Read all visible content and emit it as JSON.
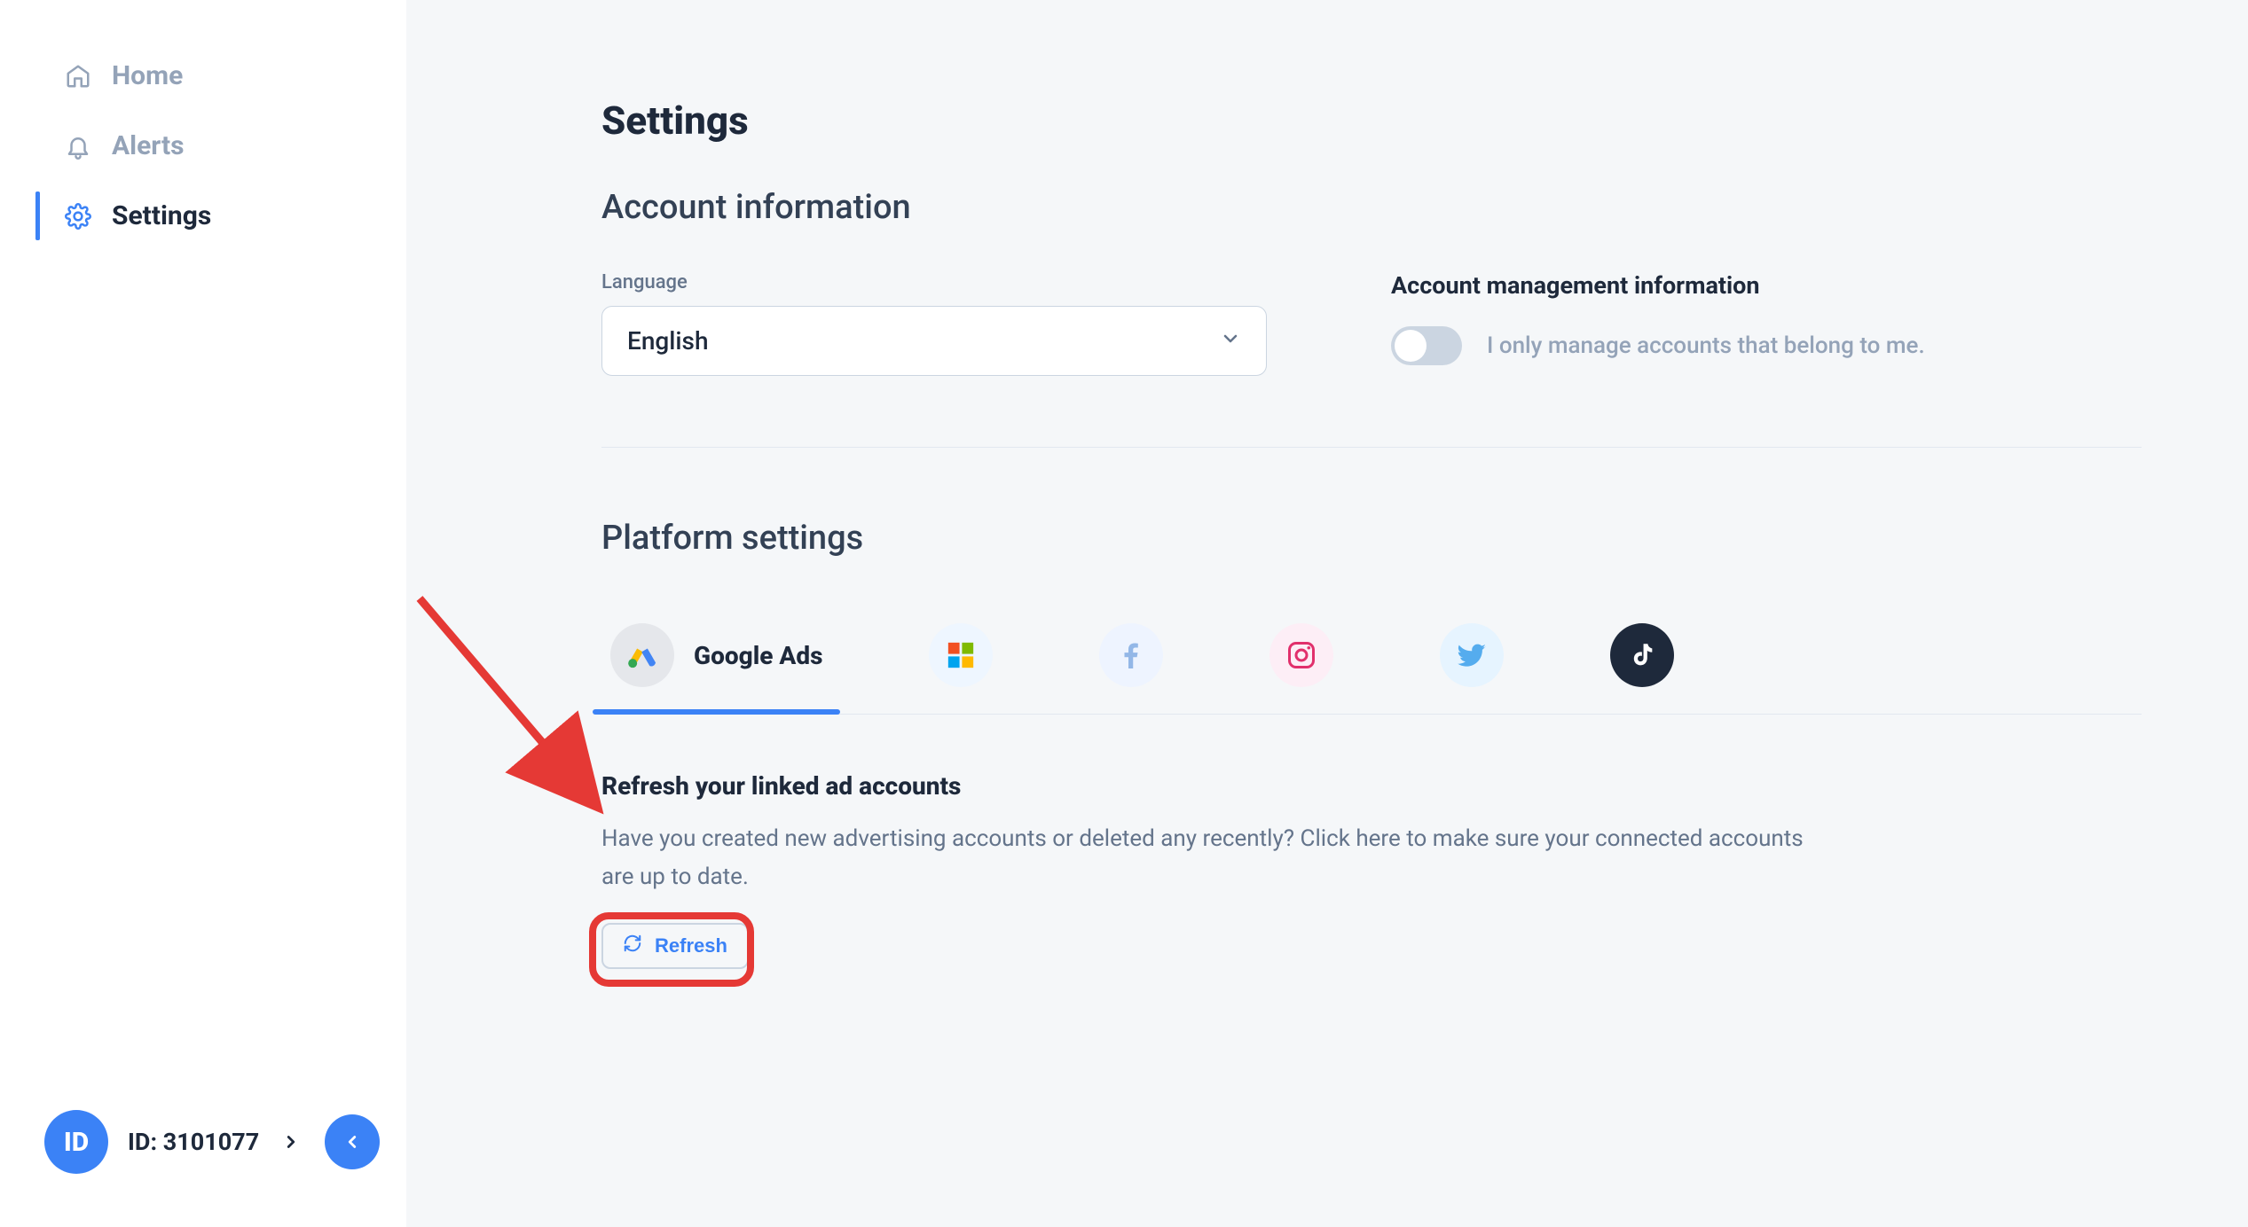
{
  "sidebar": {
    "items": [
      {
        "label": "Home"
      },
      {
        "label": "Alerts"
      },
      {
        "label": "Settings"
      }
    ],
    "id_badge": "ID",
    "id_text": "ID: 3101077"
  },
  "page": {
    "title": "Settings",
    "account_section_title": "Account information",
    "language_label": "Language",
    "language_value": "English",
    "mgmt_title": "Account management information",
    "mgmt_toggle_label": "I only manage accounts that belong to me.",
    "platform_section_title": "Platform settings",
    "tabs": [
      {
        "label": "Google Ads"
      }
    ],
    "refresh_title": "Refresh your linked ad accounts",
    "refresh_desc": "Have you created new advertising accounts or deleted any recently? Click here to make sure your connected accounts are up to date.",
    "refresh_button": "Refresh"
  }
}
